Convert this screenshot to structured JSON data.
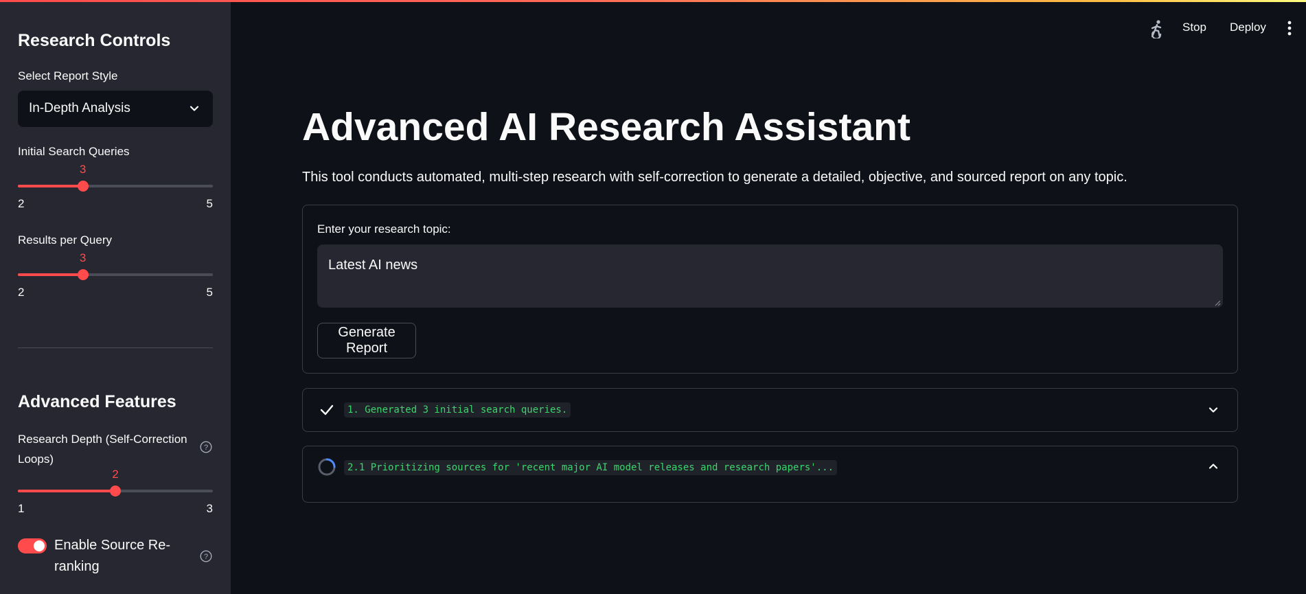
{
  "sidebar": {
    "research_controls_title": "Research Controls",
    "report_style": {
      "label": "Select Report Style",
      "selected": "In-Depth Analysis"
    },
    "initial_queries": {
      "label": "Initial Search Queries",
      "value": 3,
      "value_text": "3",
      "min": 2,
      "min_text": "2",
      "max": 5,
      "max_text": "5"
    },
    "results_per_query": {
      "label": "Results per Query",
      "value": 3,
      "value_text": "3",
      "min": 2,
      "min_text": "2",
      "max": 5,
      "max_text": "5"
    },
    "advanced_title": "Advanced Features",
    "research_depth": {
      "label": "Research Depth (Self-Correction Loops)",
      "value": 2,
      "value_text": "2",
      "min": 1,
      "min_text": "1",
      "max": 3,
      "max_text": "3"
    },
    "reranking": {
      "label": "Enable Source Re-ranking",
      "enabled": true
    }
  },
  "header": {
    "stop_label": "Stop",
    "deploy_label": "Deploy",
    "status_icon": "running-man-icon",
    "menu_icon": "kebab-menu-icon"
  },
  "main": {
    "title": "Advanced AI Research Assistant",
    "subtitle": "This tool conducts automated, multi-step research with self-correction to generate a detailed, objective, and sourced report on any topic.",
    "topic_label": "Enter your research topic:",
    "topic_value": "Latest AI news",
    "generate_label": "Generate Report"
  },
  "status_steps": [
    {
      "text": "1. Generated 3 initial search queries.",
      "state": "complete",
      "expanded": false
    },
    {
      "text": "2.1 Prioritizing sources for 'recent major AI model releases and research papers'...",
      "state": "running",
      "expanded": true
    }
  ],
  "colors": {
    "accent": "#ff4b4b",
    "background": "#0e1117",
    "sidebar": "#262730",
    "code_text": "#3dd56d"
  }
}
